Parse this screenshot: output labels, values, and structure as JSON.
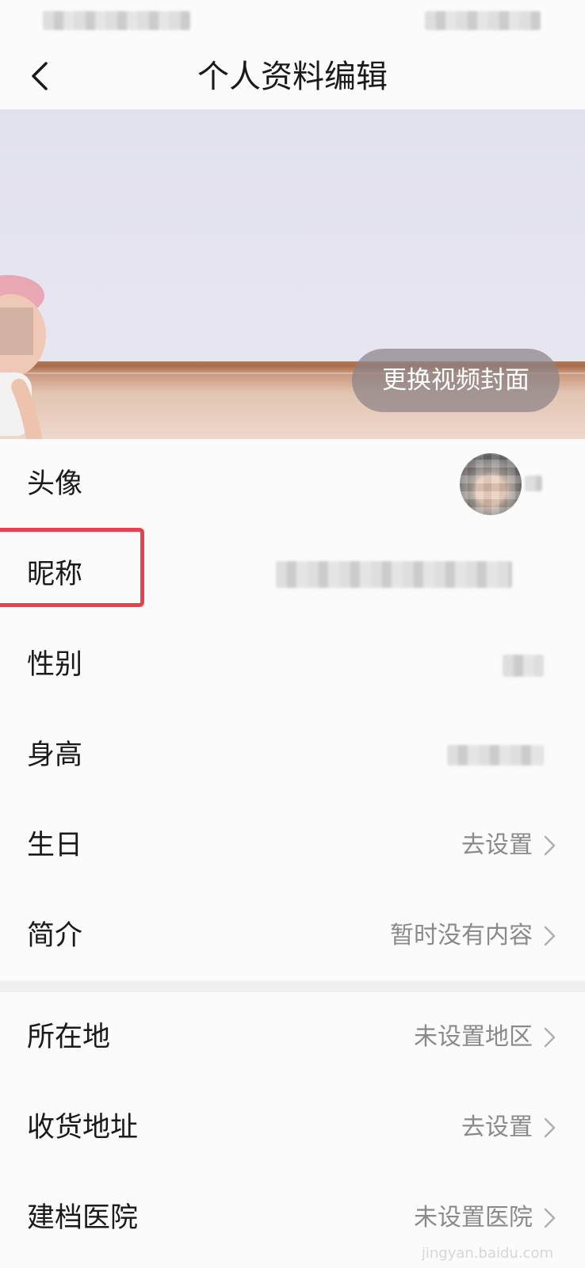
{
  "header": {
    "title": "个人资料编辑",
    "back_icon": "chevron-left-icon"
  },
  "cover": {
    "change_button_label": "更换视频封面"
  },
  "profile_rows": [
    {
      "key": "avatar",
      "label": "头像",
      "value": ""
    },
    {
      "key": "nickname",
      "label": "昵称",
      "value": ""
    },
    {
      "key": "gender",
      "label": "性别",
      "value": ""
    },
    {
      "key": "height",
      "label": "身高",
      "value": ""
    },
    {
      "key": "birthday",
      "label": "生日",
      "value": "去设置"
    },
    {
      "key": "intro",
      "label": "简介",
      "value": "暂时没有内容"
    }
  ],
  "location_rows": [
    {
      "key": "location",
      "label": "所在地",
      "value": "未设置地区"
    },
    {
      "key": "address",
      "label": "收货地址",
      "value": "去设置"
    },
    {
      "key": "hospital",
      "label": "建档医院",
      "value": "未设置医院"
    }
  ],
  "watermark": "jingyan.baidu.com",
  "colors": {
    "highlight": "#e8404d",
    "text_primary": "#1a1a1a",
    "text_secondary": "#8a8a8a",
    "background": "#fbfbfb"
  }
}
